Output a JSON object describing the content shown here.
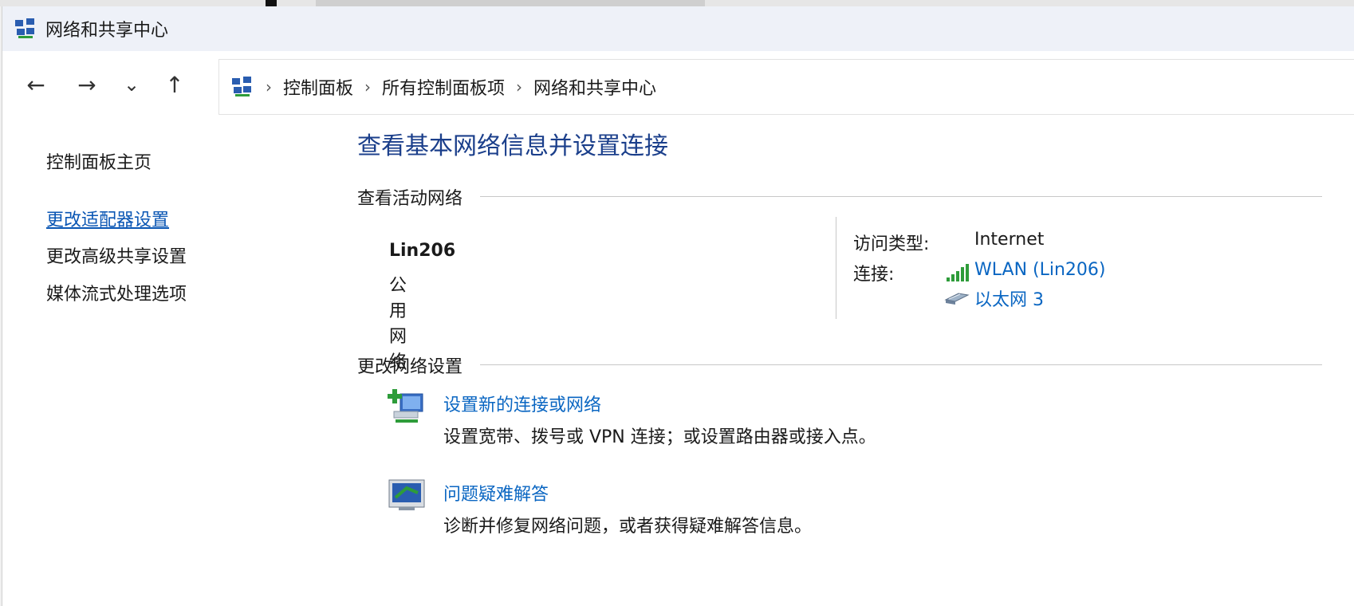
{
  "window": {
    "title": "网络和共享中心"
  },
  "nav": {
    "back": "←",
    "forward": "→",
    "recent": "⌄",
    "up": "↑"
  },
  "breadcrumb": [
    {
      "label": "控制面板"
    },
    {
      "label": "所有控制面板项"
    },
    {
      "label": "网络和共享中心"
    }
  ],
  "sidebar": {
    "items": [
      {
        "label": "控制面板主页"
      },
      {
        "label": "更改适配器设置"
      },
      {
        "label": "更改高级共享设置"
      },
      {
        "label": "媒体流式处理选项"
      }
    ]
  },
  "main": {
    "heading": "查看基本网络信息并设置连接",
    "active_section": "查看活动网络",
    "network": {
      "name": "Lin206",
      "type": "公用网络"
    },
    "access_label": "访问类型:",
    "access_value": "Internet",
    "connections_label": "连接:",
    "connections": [
      {
        "label": "WLAN (Lin206)",
        "icon": "wifi-signal-icon"
      },
      {
        "label": "以太网 3",
        "icon": "ethernet-icon"
      }
    ],
    "change_section": "更改网络设置",
    "tasks": [
      {
        "title": "设置新的连接或网络",
        "desc": "设置宽带、拨号或 VPN 连接；或设置路由器或接入点。",
        "icon": "new-connection-icon"
      },
      {
        "title": "问题疑难解答",
        "desc": "诊断并修复网络问题，或者获得疑难解答信息。",
        "icon": "troubleshoot-icon"
      }
    ]
  },
  "colors": {
    "heading": "#1b3f8b",
    "link": "#0a66c2",
    "title_bar": "#eef1f8"
  }
}
